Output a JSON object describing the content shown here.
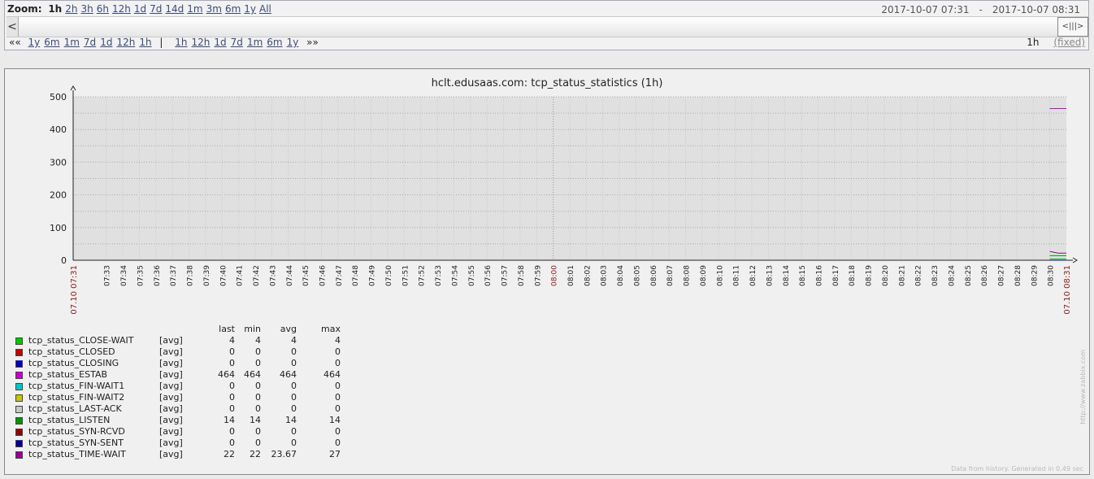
{
  "zoom": {
    "label": "Zoom:",
    "options": [
      "1h",
      "2h",
      "3h",
      "6h",
      "12h",
      "1d",
      "7d",
      "14d",
      "1m",
      "3m",
      "6m",
      "1y",
      "All"
    ],
    "active": "1h"
  },
  "period": {
    "from": "2017-10-07 07:31",
    "dash": "-",
    "to": "2017-10-07 08:31"
  },
  "nav": {
    "back_symbol": "««",
    "back": [
      "1y",
      "6m",
      "1m",
      "7d",
      "1d",
      "12h",
      "1h"
    ],
    "separator": "|",
    "forward": [
      "1h",
      "12h",
      "1d",
      "7d",
      "1m",
      "6m",
      "1y"
    ],
    "forward_symbol": "»»",
    "period_value": "1h",
    "fixed_label": "(fixed)"
  },
  "scroll": {
    "left_arrow": "<",
    "thumb_glyph": "<|||>"
  },
  "graph": {
    "title": "hclt.edusaas.com: tcp_status_statistics (1h)",
    "footer": "Data from history. Generated in 0.49 sec",
    "watermark": "http://www.zabbix.com"
  },
  "legend": {
    "headers": [
      "last",
      "min",
      "avg",
      "max"
    ],
    "items": [
      {
        "name": "tcp_status_CLOSE-WAIT",
        "fn": "[avg]",
        "last": "4",
        "min": "4",
        "avg": "4",
        "max": "4",
        "color": "#00c800"
      },
      {
        "name": "tcp_status_CLOSED",
        "fn": "[avg]",
        "last": "0",
        "min": "0",
        "avg": "0",
        "max": "0",
        "color": "#c80000"
      },
      {
        "name": "tcp_status_CLOSING",
        "fn": "[avg]",
        "last": "0",
        "min": "0",
        "avg": "0",
        "max": "0",
        "color": "#0000c8"
      },
      {
        "name": "tcp_status_ESTAB",
        "fn": "[avg]",
        "last": "464",
        "min": "464",
        "avg": "464",
        "max": "464",
        "color": "#c800c8"
      },
      {
        "name": "tcp_status_FIN-WAIT1",
        "fn": "[avg]",
        "last": "0",
        "min": "0",
        "avg": "0",
        "max": "0",
        "color": "#00c8c8"
      },
      {
        "name": "tcp_status_FIN-WAIT2",
        "fn": "[avg]",
        "last": "0",
        "min": "0",
        "avg": "0",
        "max": "0",
        "color": "#c8c800"
      },
      {
        "name": "tcp_status_LAST-ACK",
        "fn": "[avg]",
        "last": "0",
        "min": "0",
        "avg": "0",
        "max": "0",
        "color": "#c8c8c8"
      },
      {
        "name": "tcp_status_LISTEN",
        "fn": "[avg]",
        "last": "14",
        "min": "14",
        "avg": "14",
        "max": "14",
        "color": "#009600"
      },
      {
        "name": "tcp_status_SYN-RCVD",
        "fn": "[avg]",
        "last": "0",
        "min": "0",
        "avg": "0",
        "max": "0",
        "color": "#960000"
      },
      {
        "name": "tcp_status_SYN-SENT",
        "fn": "[avg]",
        "last": "0",
        "min": "0",
        "avg": "0",
        "max": "0",
        "color": "#000096"
      },
      {
        "name": "tcp_status_TIME-WAIT",
        "fn": "[avg]",
        "last": "22",
        "min": "22",
        "avg": "23.67",
        "max": "27",
        "color": "#960096"
      }
    ]
  },
  "chart_data": {
    "type": "line",
    "title": "hclt.edusaas.com: tcp_status_statistics (1h)",
    "ylim": [
      0,
      500
    ],
    "yticks": [
      0,
      100,
      200,
      300,
      400,
      500
    ],
    "x_start_label": "07.10 07:31",
    "x_end_label": "07.10 08:31",
    "x_tick_labels": [
      "07:33",
      "07:34",
      "07:35",
      "07:36",
      "07:37",
      "07:38",
      "07:39",
      "07:40",
      "07:41",
      "07:42",
      "07:43",
      "07:44",
      "07:45",
      "07:46",
      "07:47",
      "07:48",
      "07:49",
      "07:50",
      "07:51",
      "07:52",
      "07:53",
      "07:54",
      "07:55",
      "07:56",
      "07:57",
      "07:58",
      "07:59",
      "08:00",
      "08:01",
      "08:02",
      "08:03",
      "08:04",
      "08:05",
      "08:06",
      "08:07",
      "08:08",
      "08:09",
      "08:10",
      "08:11",
      "08:12",
      "08:13",
      "08:14",
      "08:15",
      "08:16",
      "08:17",
      "08:18",
      "08:19",
      "08:20",
      "08:21",
      "08:22",
      "08:23",
      "08:24",
      "08:25",
      "08:26",
      "08:27",
      "08:28",
      "08:29",
      "08:30"
    ],
    "highlight_labels": [
      "08:00"
    ],
    "xlim_minutes": [
      0,
      60
    ],
    "data_start_minute": 59,
    "series": [
      {
        "name": "tcp_status_CLOSE-WAIT",
        "color": "#00c800",
        "x": [
          59,
          60
        ],
        "y": [
          4,
          4
        ]
      },
      {
        "name": "tcp_status_CLOSED",
        "color": "#c80000",
        "x": [
          59,
          60
        ],
        "y": [
          0,
          0
        ]
      },
      {
        "name": "tcp_status_CLOSING",
        "color": "#0000c8",
        "x": [
          59,
          60
        ],
        "y": [
          0,
          0
        ]
      },
      {
        "name": "tcp_status_ESTAB",
        "color": "#c800c8",
        "x": [
          59,
          60
        ],
        "y": [
          464,
          464
        ]
      },
      {
        "name": "tcp_status_FIN-WAIT1",
        "color": "#00c8c8",
        "x": [
          59,
          60
        ],
        "y": [
          0,
          0
        ]
      },
      {
        "name": "tcp_status_FIN-WAIT2",
        "color": "#c8c800",
        "x": [
          59,
          60
        ],
        "y": [
          0,
          0
        ]
      },
      {
        "name": "tcp_status_LAST-ACK",
        "color": "#c8c8c8",
        "x": [
          59,
          60
        ],
        "y": [
          0,
          0
        ]
      },
      {
        "name": "tcp_status_LISTEN",
        "color": "#009600",
        "x": [
          59,
          60
        ],
        "y": [
          14,
          14
        ]
      },
      {
        "name": "tcp_status_SYN-RCVD",
        "color": "#960000",
        "x": [
          59,
          60
        ],
        "y": [
          0,
          0
        ]
      },
      {
        "name": "tcp_status_SYN-SENT",
        "color": "#000096",
        "x": [
          59,
          60
        ],
        "y": [
          0,
          0
        ]
      },
      {
        "name": "tcp_status_TIME-WAIT",
        "color": "#960096",
        "x": [
          59,
          59.5,
          60
        ],
        "y": [
          27,
          22,
          22
        ]
      }
    ]
  }
}
